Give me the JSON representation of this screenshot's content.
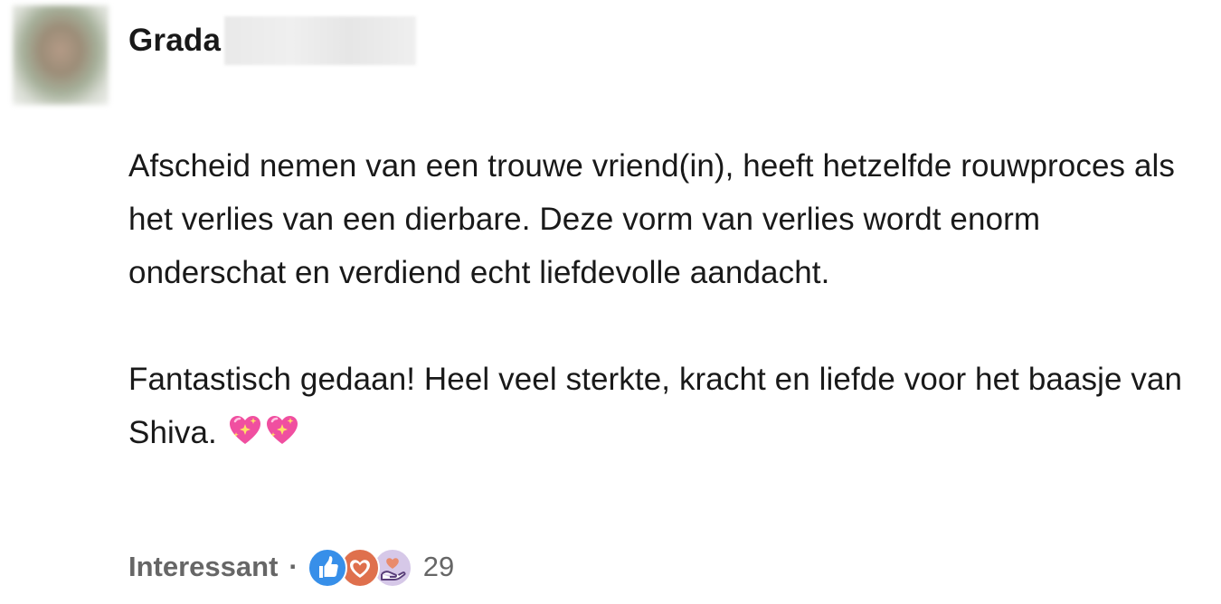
{
  "author": {
    "first_name": "Grada"
  },
  "comment": {
    "paragraph_1": "Afscheid nemen van een trouwe vriend(in), heeft hetzelfde rouwproces als het verlies van een dierbare. Deze vorm van verlies wordt enorm onderschat en verdiend echt liefdevolle aandacht.",
    "paragraph_2": "Fantastisch gedaan! Heel veel sterkte, kracht en liefde voor het baasje van Shiva.",
    "emoji": [
      "sparkling-heart",
      "sparkling-heart"
    ]
  },
  "footer": {
    "reaction_label": "Interessant",
    "separator": "·",
    "reaction_icons": [
      "like-icon",
      "love-icon",
      "support-icon"
    ],
    "reaction_count": "29"
  },
  "colors": {
    "like": "#378fe9",
    "love": "#df704d",
    "support": "#d6c8e8",
    "text": "#191919",
    "muted": "#666666"
  }
}
